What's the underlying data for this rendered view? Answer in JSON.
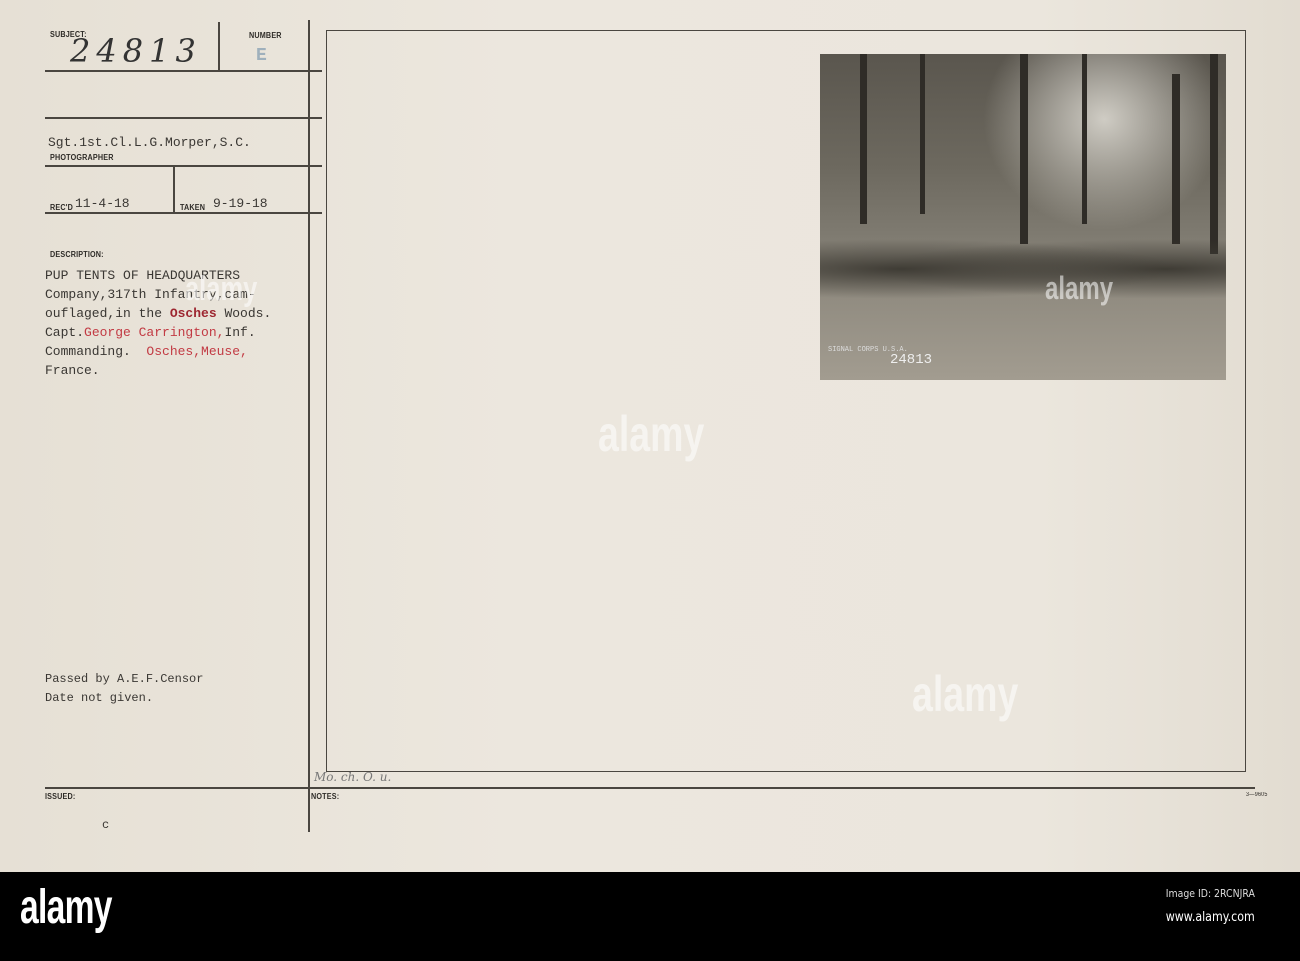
{
  "card": {
    "subject_label": "SUBJECT:",
    "subject_number": "24813",
    "number_label": "NUMBER",
    "number_value": "E",
    "photographer": "Sgt.1st.Cl.L.G.Morper,S.C.",
    "photographer_label": "PHOTOGRAPHER",
    "received_label": "REC'D",
    "received_date": "11-4-18",
    "taken_label": "TAKEN",
    "taken_date": "9-19-18",
    "description_label": "DESCRIPTION:",
    "description": {
      "line1": "PUP TENTS OF HEADQUARTERS",
      "line2": "Company,317th Infantry,cam-",
      "line3a": "ouflaged,in the ",
      "line3b": "Osches",
      "line3c": " Woods.",
      "line4a": "Capt.",
      "line4b": "George Carrington,",
      "line4c": "Inf.",
      "line5a": "Commanding.  ",
      "line5b": "Osches,Meuse,",
      "line6": "France."
    },
    "censor_line1": "Passed by A.E.F.Censor",
    "censor_line2": "Date not given.",
    "handwritten_note": "Mo. ch. O. u.",
    "issued_label": "ISSUED:",
    "issued_mark": "c",
    "notes_label": "NOTES:",
    "form_number": "3—9605",
    "photo_stamp": "SIGNAL CORPS U.S.A.",
    "photo_number": "24813"
  },
  "watermark": "alamy",
  "footer": {
    "logo": "alamy",
    "image_id": "Image ID: 2RCNJRA",
    "url": "www.alamy.com"
  }
}
